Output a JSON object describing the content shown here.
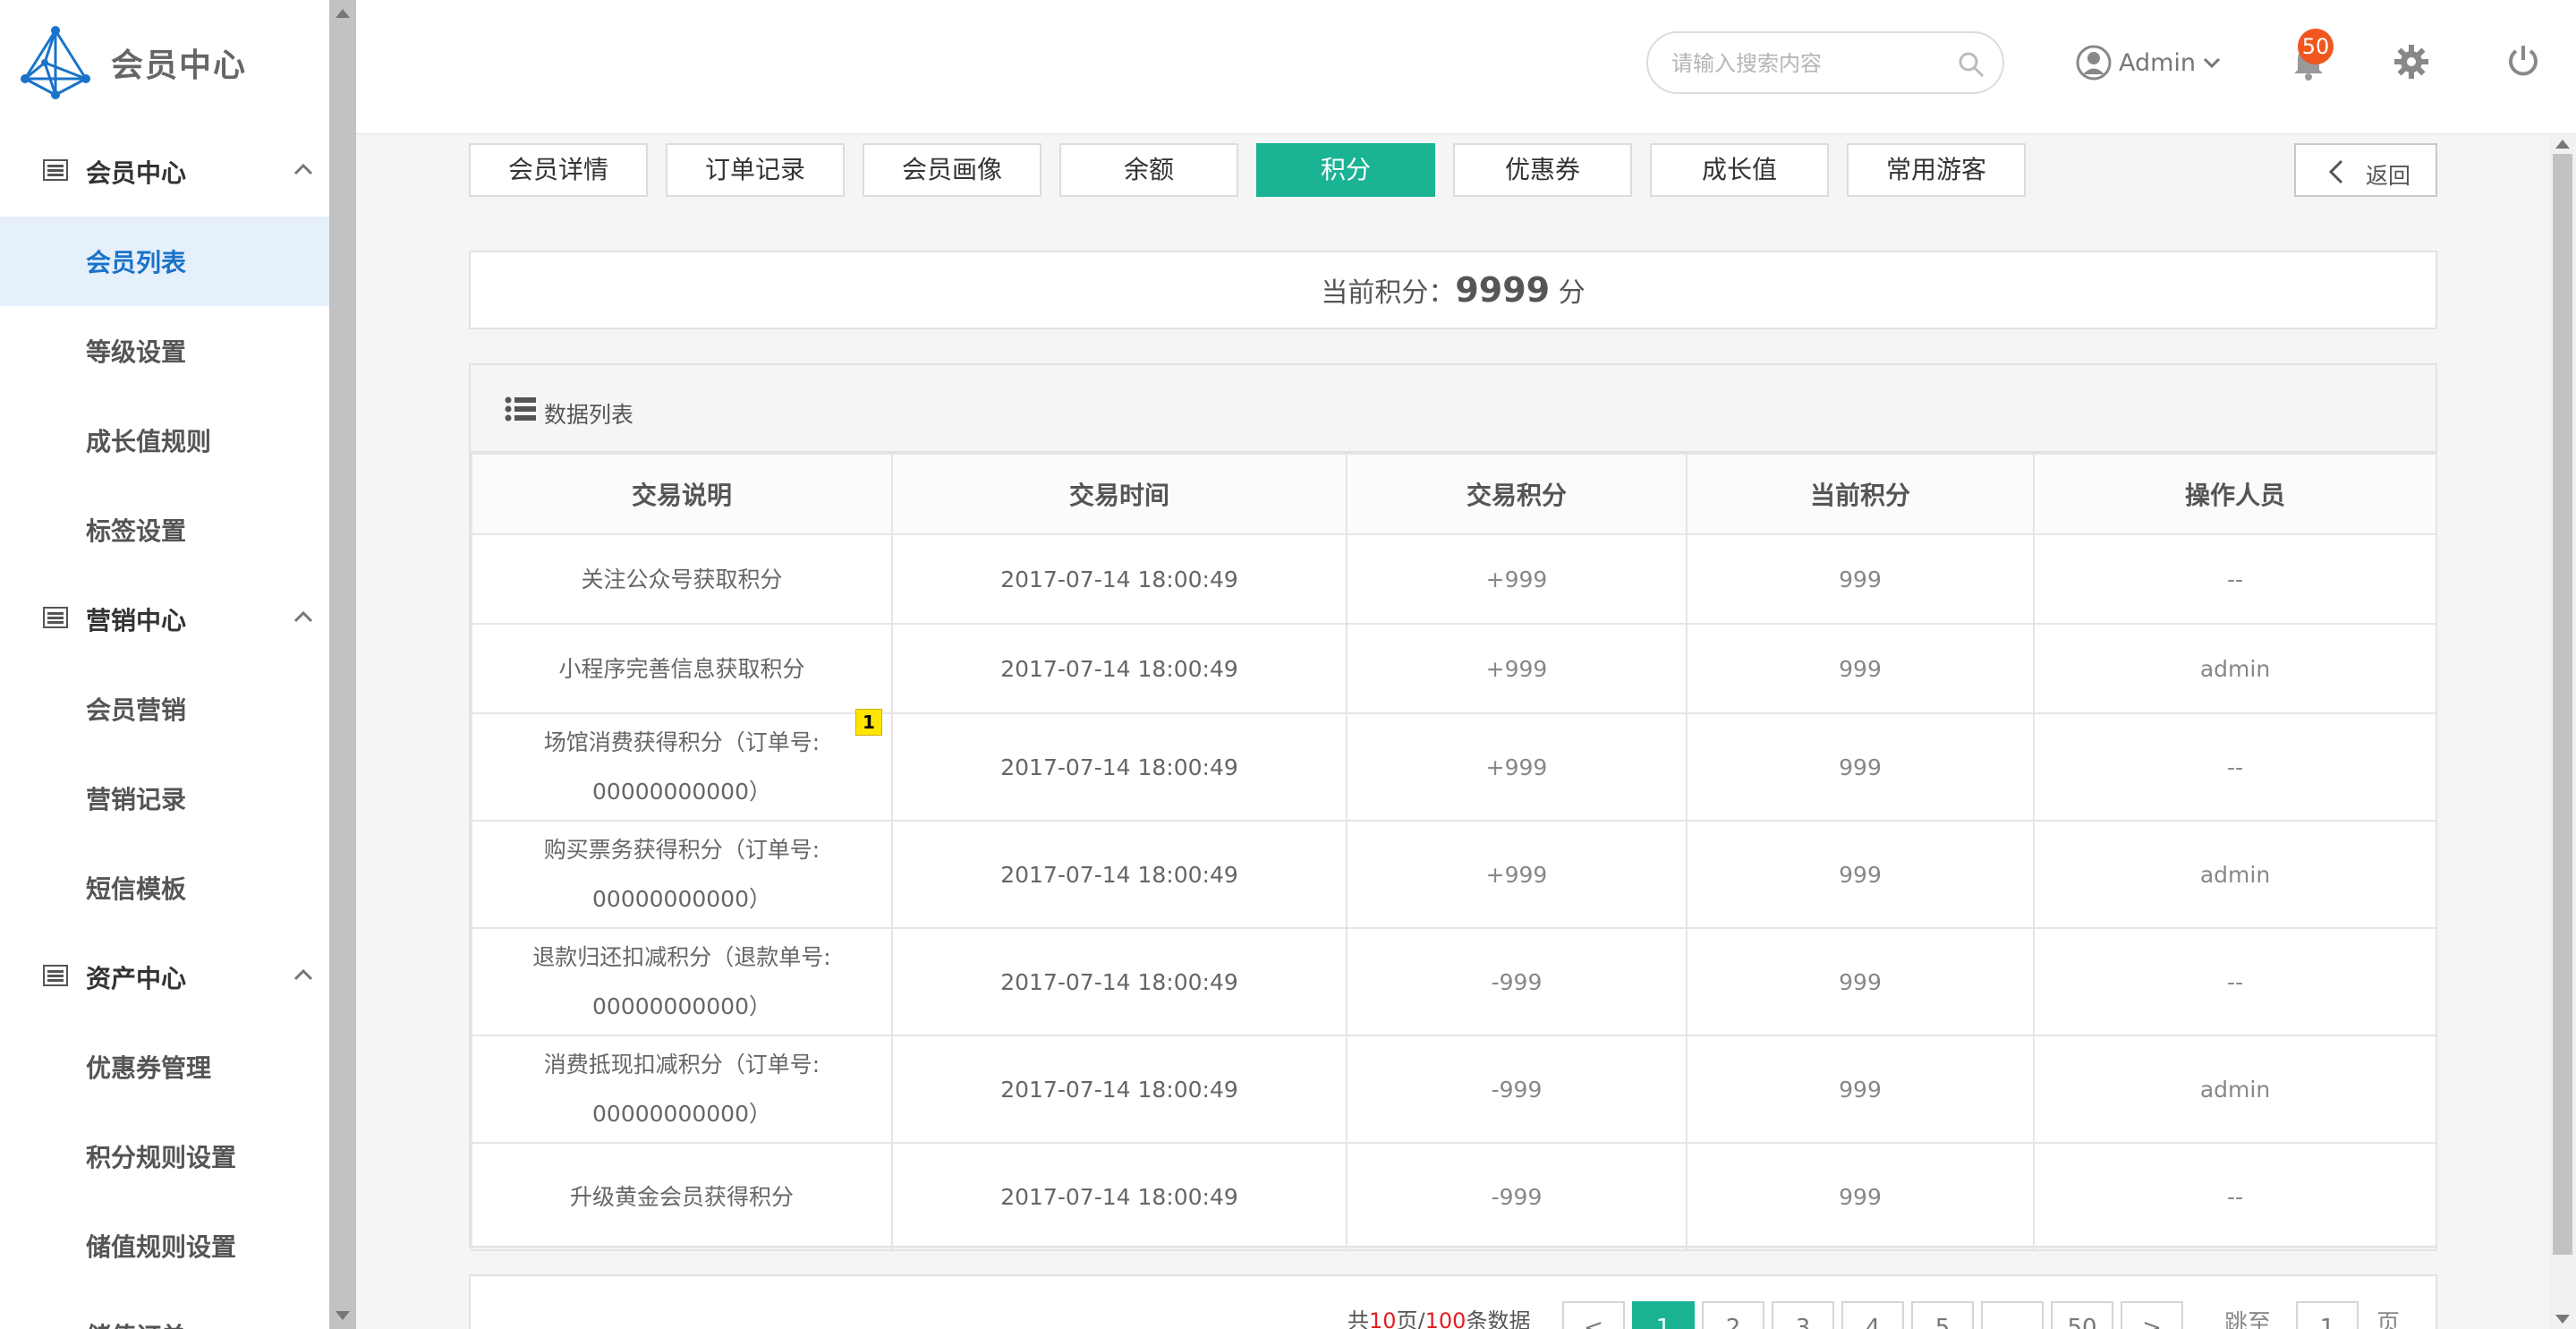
{
  "app": {
    "title": "会员中心"
  },
  "sidebar": {
    "groups": [
      {
        "label": "会员中心",
        "items": [
          "会员列表",
          "等级设置",
          "成长值规则",
          "标签设置"
        ]
      },
      {
        "label": "营销中心",
        "items": [
          "会员营销",
          "营销记录",
          "短信模板"
        ]
      },
      {
        "label": "资产中心",
        "items": [
          "优惠券管理",
          "积分规则设置",
          "储值规则设置",
          "储值订单"
        ]
      }
    ],
    "active_item": "会员列表"
  },
  "header": {
    "search_placeholder": "请输入搜索内容",
    "username": "Admin",
    "notification_count": "50"
  },
  "tabs": [
    {
      "label": "会员详情",
      "active": false
    },
    {
      "label": "订单记录",
      "active": false
    },
    {
      "label": "会员画像",
      "active": false
    },
    {
      "label": "余额",
      "active": false
    },
    {
      "label": "积分",
      "active": true
    },
    {
      "label": "优惠券",
      "active": false
    },
    {
      "label": "成长值",
      "active": false
    },
    {
      "label": "常用游客",
      "active": false
    }
  ],
  "back_label": "返回",
  "points": {
    "label": "当前积分：",
    "value": "9999",
    "unit": "分"
  },
  "table": {
    "title": "数据列表",
    "columns": [
      "交易说明",
      "交易时间",
      "交易积分",
      "当前积分",
      "操作人员"
    ],
    "rows": [
      {
        "desc": [
          "关注公众号获取积分"
        ],
        "time": "2017-07-14 18:00:49",
        "points": "+999",
        "current": "999",
        "operator": "--"
      },
      {
        "desc": [
          "小程序完善信息获取积分"
        ],
        "time": "2017-07-14 18:00:49",
        "points": "+999",
        "current": "999",
        "operator": "admin"
      },
      {
        "desc": [
          "场馆消费获得积分（订单号:",
          "00000000000）"
        ],
        "time": "2017-07-14 18:00:49",
        "points": "+999",
        "current": "999",
        "operator": "--"
      },
      {
        "desc": [
          "购买票务获得积分（订单号:",
          "00000000000）"
        ],
        "time": "2017-07-14 18:00:49",
        "points": "+999",
        "current": "999",
        "operator": "admin"
      },
      {
        "desc": [
          "退款归还扣减积分（退款单号:",
          "00000000000）"
        ],
        "time": "2017-07-14 18:00:49",
        "points": "-999",
        "current": "999",
        "operator": "--"
      },
      {
        "desc": [
          "消费抵现扣减积分（订单号:",
          "00000000000）"
        ],
        "time": "2017-07-14 18:00:49",
        "points": "-999",
        "current": "999",
        "operator": "admin"
      },
      {
        "desc": [
          "升级黄金会员获得积分"
        ],
        "time": "2017-07-14 18:00:49",
        "points": "-999",
        "current": "999",
        "operator": "--"
      }
    ],
    "marker": "1"
  },
  "pagination": {
    "prefix": "共",
    "pages": "10",
    "mid": "页/",
    "total": "100",
    "suffix": "条数据",
    "prev": "<",
    "next": ">",
    "buttons": [
      "1",
      "2",
      "3",
      "4",
      "5",
      "...",
      "50"
    ],
    "active": "1",
    "jump_label": "跳至",
    "jump_value": "1",
    "jump_unit": "页"
  }
}
